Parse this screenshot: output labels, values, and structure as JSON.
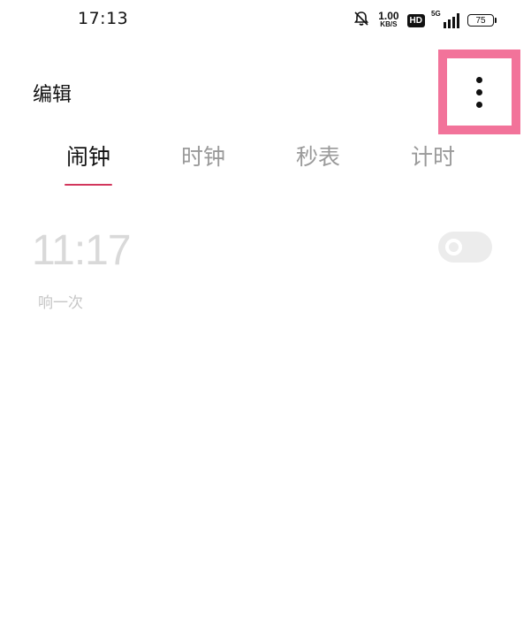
{
  "status_bar": {
    "time": "17:13",
    "net_speed_value": "1.00",
    "net_speed_unit": "KB/S",
    "hd_badge": "HD",
    "network_type": "5G",
    "battery_level": "75",
    "icons": [
      "mute-bell-icon",
      "signal-icon",
      "battery-icon"
    ]
  },
  "header": {
    "edit_label": "编辑",
    "more_icon": "more-vertical-icon",
    "highlight_color": "#f2739a"
  },
  "tabs": [
    {
      "label": "闹钟",
      "active": true
    },
    {
      "label": "时钟",
      "active": false
    },
    {
      "label": "秒表",
      "active": false
    },
    {
      "label": "计时",
      "active": false
    }
  ],
  "accent_color": "#d2365c",
  "alarms": [
    {
      "time": "11:17",
      "repeat": "响一次",
      "enabled": false
    }
  ]
}
